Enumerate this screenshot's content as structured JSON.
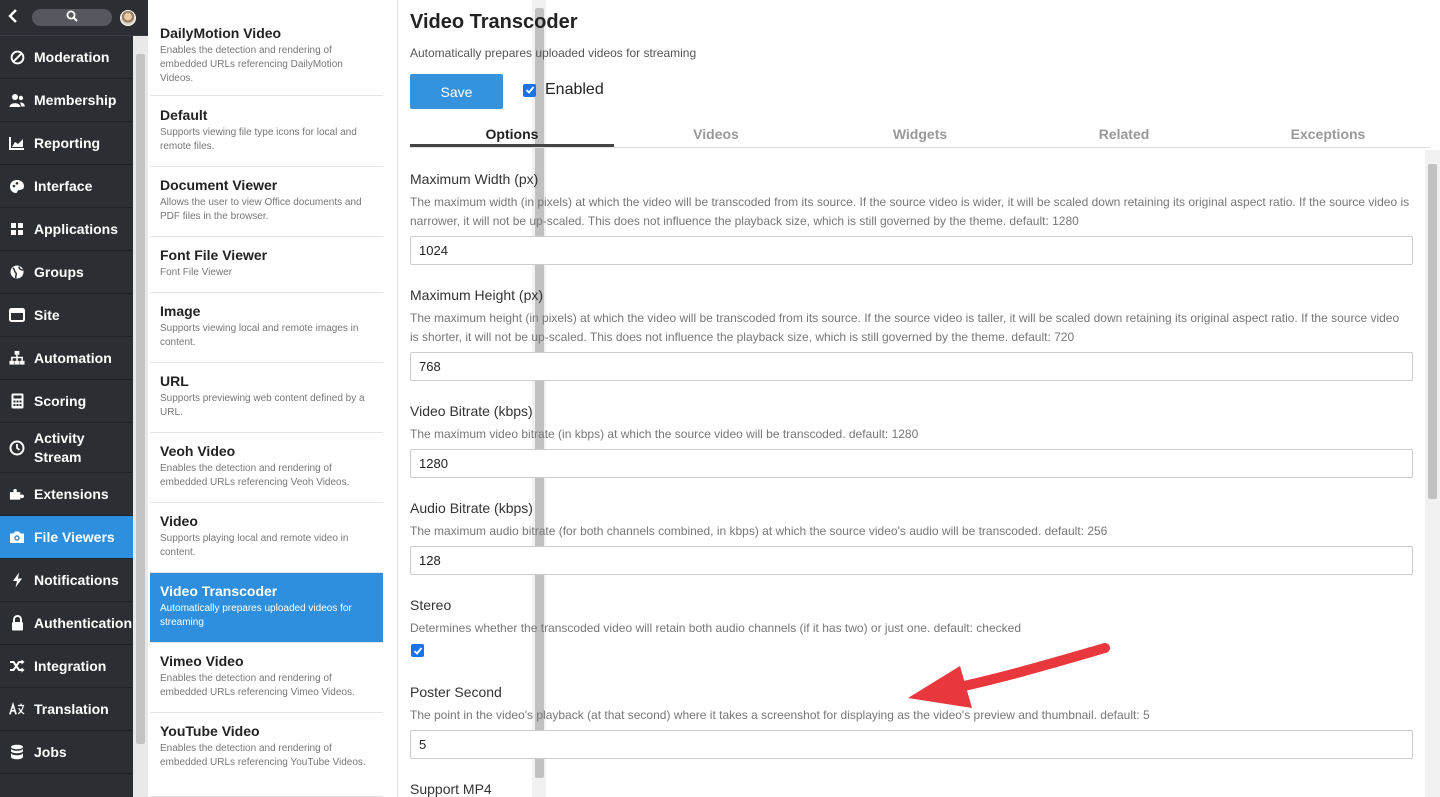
{
  "nav": {
    "items": [
      {
        "label": "Moderation",
        "icon": "block-icon"
      },
      {
        "label": "Membership",
        "icon": "users-icon"
      },
      {
        "label": "Reporting",
        "icon": "chart-icon"
      },
      {
        "label": "Interface",
        "icon": "palette-icon"
      },
      {
        "label": "Applications",
        "icon": "grid-icon"
      },
      {
        "label": "Groups",
        "icon": "globe-icon"
      },
      {
        "label": "Site",
        "icon": "window-icon"
      },
      {
        "label": "Automation",
        "icon": "sitemap-icon"
      },
      {
        "label": "Scoring",
        "icon": "calculator-icon"
      },
      {
        "label": "Activity Stream",
        "icon": "clock-icon"
      },
      {
        "label": "Extensions",
        "icon": "puzzle-icon"
      },
      {
        "label": "File Viewers",
        "icon": "camera-icon",
        "active": true
      },
      {
        "label": "Notifications",
        "icon": "bolt-icon"
      },
      {
        "label": "Authentication",
        "icon": "lock-icon"
      },
      {
        "label": "Integration",
        "icon": "shuffle-icon"
      },
      {
        "label": "Translation",
        "icon": "language-icon"
      },
      {
        "label": "Jobs",
        "icon": "database-icon"
      }
    ]
  },
  "list": {
    "items": [
      {
        "title": "DailyMotion Video",
        "desc": "Enables the detection and rendering of embedded URLs referencing DailyMotion Videos."
      },
      {
        "title": "Default",
        "desc": "Supports viewing file type icons for local and remote files."
      },
      {
        "title": "Document Viewer",
        "desc": "Allows the user to view Office documents and PDF files in the browser."
      },
      {
        "title": "Font File Viewer",
        "desc": "Font File Viewer"
      },
      {
        "title": "Image",
        "desc": "Supports viewing local and remote images in content."
      },
      {
        "title": "URL",
        "desc": "Supports previewing web content defined by a URL."
      },
      {
        "title": "Veoh Video",
        "desc": "Enables the detection and rendering of embedded URLs referencing Veoh Videos."
      },
      {
        "title": "Video",
        "desc": "Supports playing local and remote video in content."
      },
      {
        "title": "Video Transcoder",
        "desc": "Automatically prepares uploaded videos for streaming",
        "active": true
      },
      {
        "title": "Vimeo Video",
        "desc": "Enables the detection and rendering of embedded URLs referencing Vimeo Videos."
      },
      {
        "title": "YouTube Video",
        "desc": "Enables the detection and rendering of embedded URLs referencing YouTube Videos."
      }
    ]
  },
  "main": {
    "title": "Video Transcoder",
    "subtitle": "Automatically prepares uploaded videos for streaming",
    "save_label": "Save",
    "enabled_label": "Enabled",
    "enabled": true,
    "tabs": [
      "Options",
      "Videos",
      "Widgets",
      "Related",
      "Exceptions"
    ],
    "active_tab": "Options"
  },
  "fields": {
    "max_width": {
      "label": "Maximum Width (px)",
      "desc": "The maximum width (in pixels) at which the video will be transcoded from its source. If the source video is wider, it will be scaled down retaining its original aspect ratio. If the source video is narrower, it will not be up-scaled. This does not influence the playback size, which is still governed by the theme. default: 1280",
      "value": "1024"
    },
    "max_height": {
      "label": "Maximum Height (px)",
      "desc": "The maximum height (in pixels) at which the video will be transcoded from its source. If the source video is taller, it will be scaled down retaining its original aspect ratio. If the source video is shorter, it will not be up-scaled. This does not influence the playback size, which is still governed by the theme. default: 720",
      "value": "768"
    },
    "video_bitrate": {
      "label": "Video Bitrate (kbps)",
      "desc": "The maximum video bitrate (in kbps) at which the source video will be transcoded. default: 1280",
      "value": "1280"
    },
    "audio_bitrate": {
      "label": "Audio Bitrate (kbps)",
      "desc": "The maximum audio bitrate (for both channels combined, in kbps) at which the source video's audio will be transcoded. default: 256",
      "value": "128"
    },
    "stereo": {
      "label": "Stereo",
      "desc": "Determines whether the transcoded video will retain both audio channels (if it has two) or just one. default: checked",
      "checked": true
    },
    "poster_second": {
      "label": "Poster Second",
      "desc": "The point in the video's playback (at that second) where it takes a screenshot for displaying as the video's preview and thumbnail. default: 5",
      "value": "5"
    },
    "support_mp4": {
      "label": "Support MP4"
    }
  },
  "colors": {
    "accent": "#2e8fde",
    "nav_bg": "#2b2e33",
    "annotation_arrow": "#e8383d"
  }
}
